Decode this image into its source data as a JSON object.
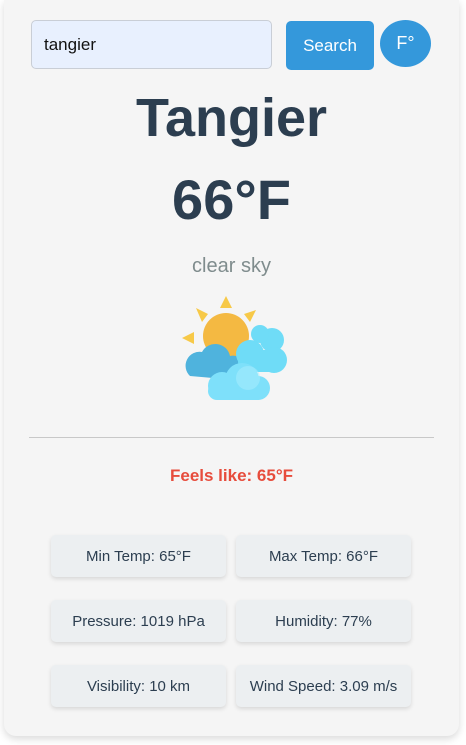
{
  "search": {
    "value": "tangier",
    "button_label": "Search"
  },
  "unit_toggle": {
    "label": "F°"
  },
  "weather": {
    "city": "Tangier",
    "temperature": "66°F",
    "description": "clear sky",
    "icon": "sun-behind-clouds-icon",
    "feels_like": "Feels like: 65°F"
  },
  "stats": [
    {
      "text": "Min Temp: 65°F"
    },
    {
      "text": "Max Temp: 66°F"
    },
    {
      "text": "Pressure: 1019 hPa"
    },
    {
      "text": "Humidity: 77%"
    },
    {
      "text": "Visibility: 10 km"
    },
    {
      "text": "Wind Speed: 3.09 m/s"
    }
  ],
  "colors": {
    "accent": "#3498db",
    "heading": "#2c3e50",
    "feels_like": "#e74c3c",
    "muted": "#7f8c8d"
  }
}
